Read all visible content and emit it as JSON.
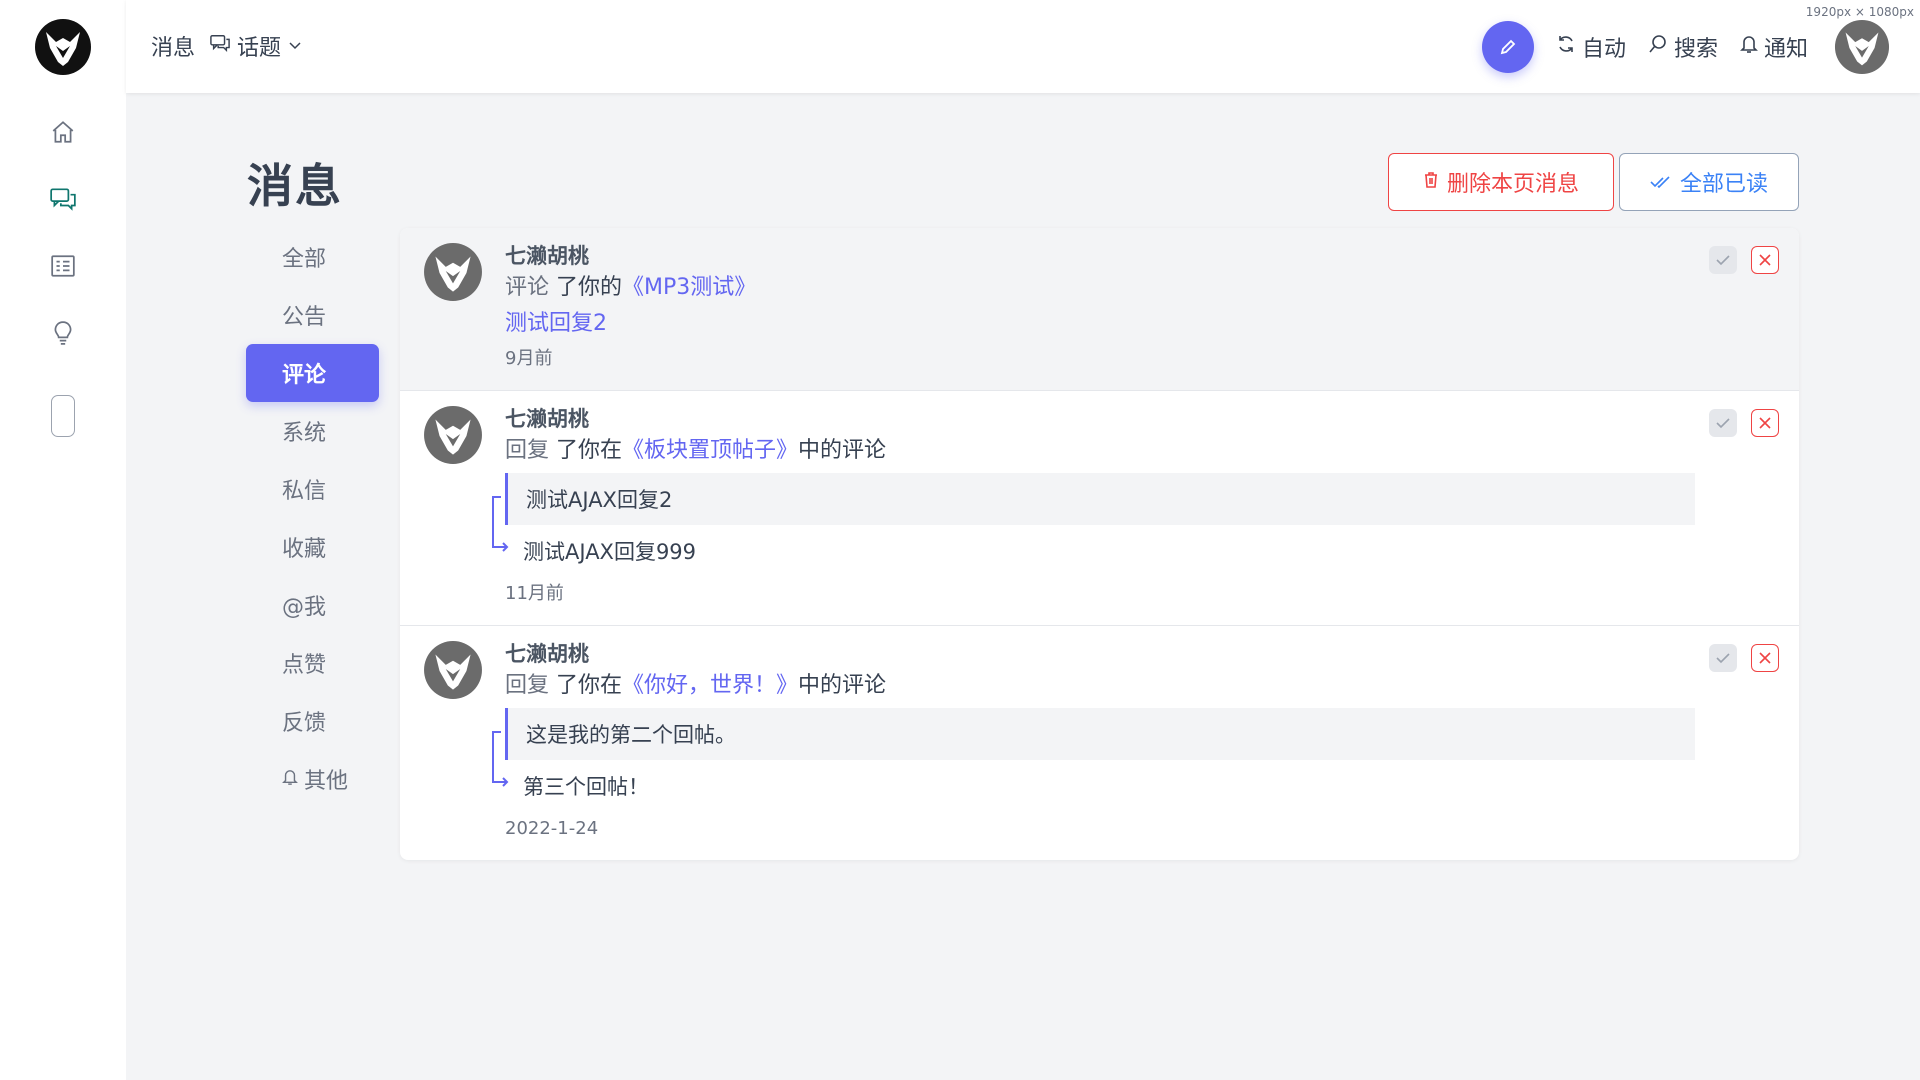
{
  "header": {
    "crumb_message": "消息",
    "crumb_topic": "话题",
    "auto_label": "自动",
    "search_label": "搜索",
    "notify_label": "通知",
    "dimension_note": "1920px × 1080px"
  },
  "page": {
    "title": "消息",
    "delete_label": "删除本页消息",
    "read_all_label": "全部已读"
  },
  "categories": [
    {
      "label": "全部"
    },
    {
      "label": "公告"
    },
    {
      "label": "评论"
    },
    {
      "label": "系统"
    },
    {
      "label": "私信"
    },
    {
      "label": "收藏"
    },
    {
      "label": "@我"
    },
    {
      "label": "点赞"
    },
    {
      "label": "反馈"
    },
    {
      "label": "其他"
    }
  ],
  "messages": [
    {
      "user": "七濑胡桃",
      "action": "评论",
      "mid": "了你的",
      "post": "《MP3测试》",
      "tail": "",
      "reply": "测试回复2",
      "time": "9月前"
    },
    {
      "user": "七濑胡桃",
      "action": "回复",
      "mid": "了你在",
      "post": "《板块置顶帖子》",
      "tail": "中的评论",
      "quote": "测试AJAX回复2",
      "sub": "测试AJAX回复999",
      "time": "11月前"
    },
    {
      "user": "七濑胡桃",
      "action": "回复",
      "mid": "了你在",
      "post": "《你好，世界！》",
      "tail": "中的评论",
      "quote": "这是我的第二个回帖。",
      "sub": "第三个回帖！",
      "time": "2022-1-24"
    }
  ],
  "colors": {
    "accent": "#6366f1",
    "danger": "#ef4444",
    "active_nav": "#0f766e"
  }
}
